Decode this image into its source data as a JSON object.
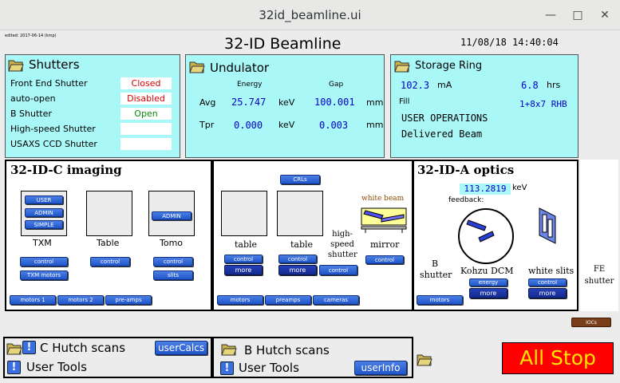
{
  "window": {
    "title": "32id_beamline.ui",
    "min_glyph": "—",
    "max_glyph": "□",
    "close_glyph": "✕"
  },
  "header": {
    "edited": "edited: 2017-06-14 (kmp)",
    "title": "32-ID Beamline",
    "datetime": "11/08/18 14:40:04"
  },
  "shutters": {
    "title": "Shutters",
    "rows": [
      {
        "label": "Front End Shutter",
        "value": "Closed",
        "color": "#d40000"
      },
      {
        "label": "auto-open",
        "value": "Disabled",
        "color": "#d40000"
      },
      {
        "label": "B Shutter",
        "value": "Open",
        "color": "#0a8a0a"
      },
      {
        "label": "High-speed Shutter",
        "value": ""
      },
      {
        "label": "USAXS CCD Shutter",
        "value": ""
      }
    ]
  },
  "undulator": {
    "title": "Undulator",
    "col_energy": "Energy",
    "col_gap": "Gap",
    "avg_label": "Avg",
    "tpr_label": "Tpr",
    "avg_energy": "25.747",
    "avg_gap": "100.001",
    "tpr_energy": "0.000",
    "tpr_gap": "0.003",
    "unit_kev": "keV",
    "unit_mm": "mm"
  },
  "storage_ring": {
    "title": "Storage Ring",
    "current": "102.3",
    "current_unit": "mA",
    "lifetime": "6.8",
    "lifetime_unit": "hrs",
    "fill_label": "Fill",
    "fill_pattern": "1+8x7 RHB",
    "operations": "USER OPERATIONS",
    "beam_status": "Delivered Beam"
  },
  "imaging": {
    "title": "32-ID-C imaging",
    "txm_buttons": [
      "USER",
      "ADMIN",
      "SIMPLE"
    ],
    "txm_label": "TXM",
    "table_label": "Table",
    "tomo_label": "Tomo",
    "tomo_admin": "ADMIN",
    "control": "control",
    "txm_motors": "TXM motors",
    "slits": "slits",
    "motors1": "motors 1",
    "motors2": "motors 2",
    "preamps": "pre-amps"
  },
  "middle": {
    "crls": "CRLs",
    "table1_label": "table",
    "table2_label": "table",
    "hs_shutter_label": "high-speed shutter",
    "white_beam": "white beam",
    "mirror_label": "mirror",
    "control": "control",
    "more": "more",
    "motors": "motors",
    "preamps": "preamps",
    "cameras": "cameras"
  },
  "optics": {
    "title": "32-ID-A optics",
    "energy_value": "113.2819",
    "energy_unit": "keV",
    "feedback": "feedback:",
    "b_shutter": "B shutter",
    "dcm_label": "Kohzu DCM",
    "white_slits_label": "white slits",
    "energy_btn": "energy",
    "control": "control",
    "more": "more",
    "motors": "motors"
  },
  "fe": {
    "shutter_label": "FE shutter",
    "iocs": "IOCs"
  },
  "bottom": {
    "c_hutch_scans": "C Hutch scans",
    "user_calcs": "userCalcs",
    "user_tools_c": "User Tools",
    "b_hutch_scans": "B Hutch scans",
    "user_tools_b": "User Tools",
    "user_info": "userInfo",
    "all_stop": "All Stop"
  },
  "colors": {
    "cyan_panel": "#aaf7f7",
    "value_blue": "#0000c8",
    "all_stop_bg": "#ff0000",
    "all_stop_fg": "#ffe600"
  }
}
